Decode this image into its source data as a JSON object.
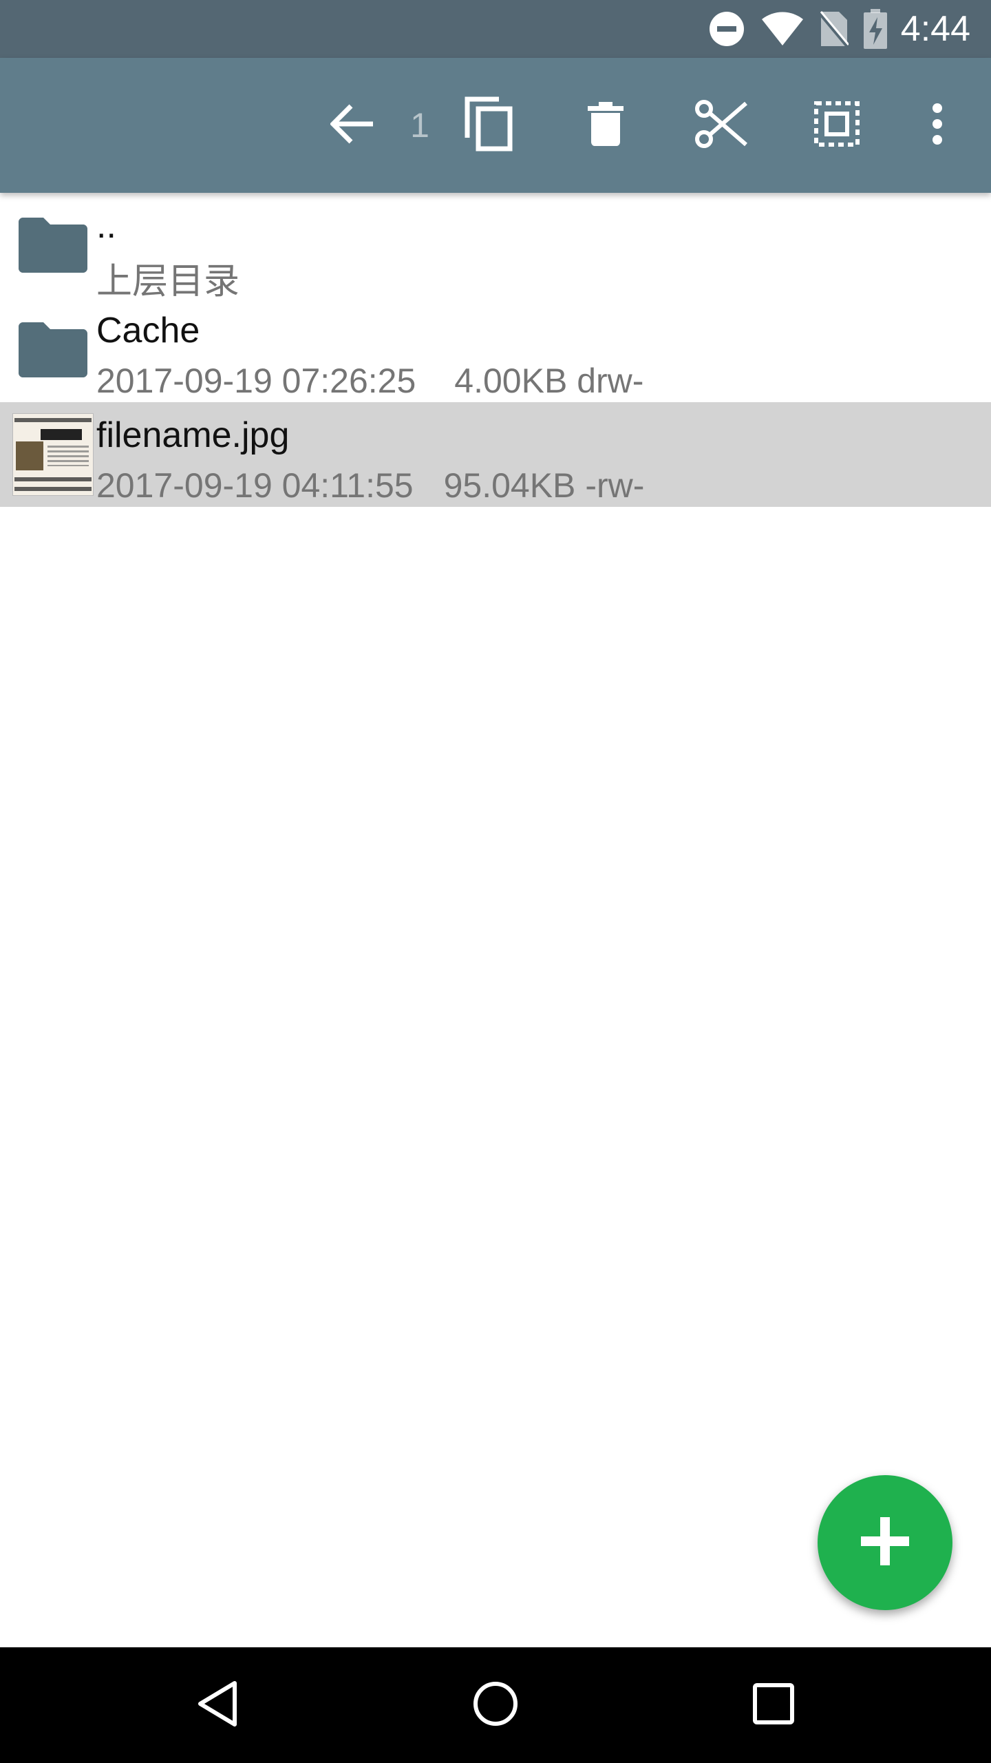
{
  "status_bar": {
    "time": "4:44",
    "icons": [
      "do-not-disturb-icon",
      "wifi-icon",
      "no-sim-icon",
      "battery-charging-icon"
    ]
  },
  "toolbar": {
    "selected_count": "1",
    "actions": [
      "back-arrow-icon",
      "copy-icon",
      "delete-icon",
      "cut-icon",
      "select-all-icon",
      "more-vert-icon"
    ]
  },
  "files": [
    {
      "name": "..",
      "subtitle": "上层目录",
      "icon": "folder-icon"
    },
    {
      "name": "Cache",
      "date": "2017-09-19 07:26:25",
      "size": "4.00KB",
      "perms": "drw-",
      "icon": "folder-icon"
    },
    {
      "name": "filename.jpg",
      "date": "2017-09-19 04:11:55",
      "size": "95.04KB",
      "perms": "-rw-",
      "icon": "image-thumbnail",
      "selected": true
    }
  ],
  "fab": {
    "icon": "plus-icon"
  },
  "colors": {
    "status_bar": "#546773",
    "toolbar": "#607d8b",
    "folder": "#546e7a",
    "selected_row": "#d3d3d3",
    "fab": "#1fb14e"
  }
}
